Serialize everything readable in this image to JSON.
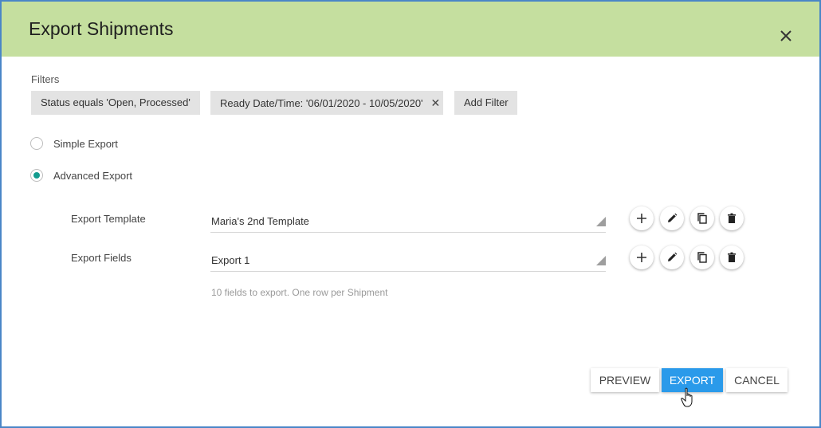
{
  "dialog": {
    "title": "Export Shipments",
    "close_icon": "close-icon"
  },
  "filters": {
    "label": "Filters",
    "chips": [
      {
        "text": "Status equals 'Open, Processed'"
      },
      {
        "text": "Ready Date/Time: '06/01/2020 - 10/05/2020'",
        "removable": true
      }
    ],
    "add_filter_label": "Add Filter"
  },
  "export_mode": {
    "options": [
      {
        "label": "Simple Export",
        "selected": false
      },
      {
        "label": "Advanced Export",
        "selected": true
      }
    ]
  },
  "template": {
    "label": "Export Template",
    "value": "Maria's 2nd Template",
    "icons": [
      "plus-icon",
      "pencil-icon",
      "copy-icon",
      "trash-icon"
    ]
  },
  "fields": {
    "label": "Export Fields",
    "value": "Export 1",
    "icons": [
      "plus-icon",
      "pencil-icon",
      "copy-icon",
      "trash-icon"
    ],
    "hint": "10 fields to export. One row per Shipment"
  },
  "actions": {
    "preview": "PREVIEW",
    "export": "EXPORT",
    "cancel": "CANCEL"
  },
  "colors": {
    "header": "#c5df9f",
    "primary": "#2a9aea",
    "radio_selected": "#149c8f",
    "border": "#4a86c7"
  }
}
